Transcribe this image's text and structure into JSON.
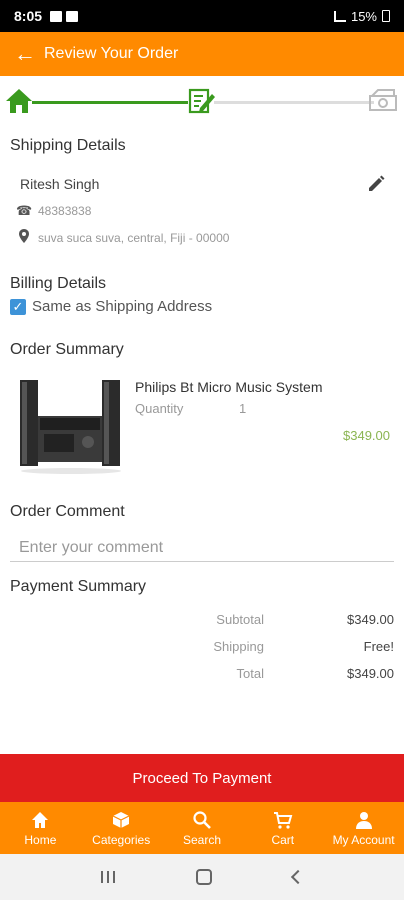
{
  "status_bar": {
    "time": "8:05",
    "battery": "15%"
  },
  "header": {
    "back_icon": "arrow-left-icon",
    "title": "Review Your Order"
  },
  "stepper": {
    "steps": [
      "home-icon",
      "edit-icon",
      "cash-icon"
    ],
    "active_color": "#3a9a1e"
  },
  "shipping": {
    "heading": "Shipping Details",
    "name": "Ritesh Singh",
    "phone": "48383838",
    "address": "suva suca suva, central, Fiji - 00000"
  },
  "billing": {
    "heading": "Billing Details",
    "same_as_shipping_label": "Same as Shipping Address",
    "same_as_shipping_checked": true
  },
  "order_summary": {
    "heading": "Order Summary",
    "item": {
      "name": "Philips Bt Micro Music System",
      "quantity_label": "Quantity",
      "quantity": "1",
      "price": "$349.00"
    }
  },
  "order_comment": {
    "heading": "Order Comment",
    "placeholder": "Enter your comment",
    "value": ""
  },
  "payment_summary": {
    "heading": "Payment Summary",
    "rows": [
      {
        "label": "Subtotal",
        "value": "$349.00"
      },
      {
        "label": "Shipping",
        "value": "Free!"
      },
      {
        "label": "Total",
        "value": "$349.00"
      }
    ]
  },
  "proceed_button": {
    "label": "Proceed To Payment",
    "color": "#e01e1e"
  },
  "bottom_nav": {
    "items": [
      {
        "label": "Home",
        "icon": "home-icon"
      },
      {
        "label": "Categories",
        "icon": "box-icon"
      },
      {
        "label": "Search",
        "icon": "search-icon"
      },
      {
        "label": "Cart",
        "icon": "cart-icon"
      },
      {
        "label": "My Account",
        "icon": "user-icon"
      }
    ]
  },
  "colors": {
    "brand": "#ff8a00",
    "price": "#8bb552"
  }
}
